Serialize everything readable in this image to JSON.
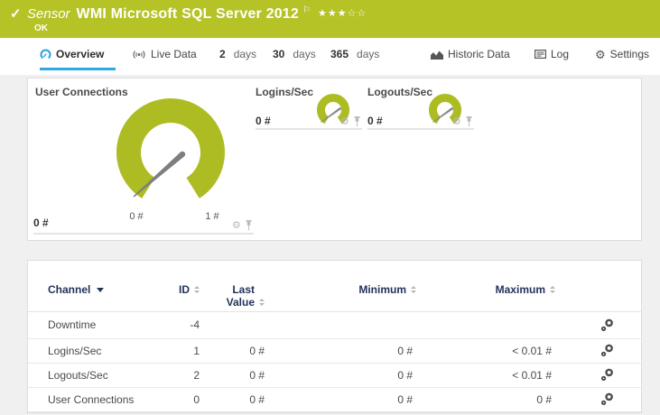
{
  "colors": {
    "status_ok_green": "#b5c327",
    "gauge_green": "#adbc23",
    "tab_active_blue": "#2da9e2"
  },
  "icons": {
    "check": "✓",
    "flag": "⚐",
    "gear": "⚙"
  },
  "header": {
    "kind_label": "Sensor",
    "title": "WMI Microsoft SQL Server 2012",
    "stars": "★★★☆☆",
    "status": "OK"
  },
  "tabs": [
    {
      "label": "Overview",
      "active": true
    },
    {
      "label": "Live Data"
    },
    {
      "num": "2",
      "unit": "days"
    },
    {
      "num": "30",
      "unit": "days"
    },
    {
      "num": "365",
      "unit": "days"
    },
    {
      "label": "Historic Data"
    },
    {
      "label": "Log"
    },
    {
      "label": "Settings"
    }
  ],
  "gauges": {
    "user_connections": {
      "title": "User Connections",
      "value": "0 #",
      "scale_min": "0 #",
      "scale_max": "1 #"
    },
    "logins_sec": {
      "title": "Logins/Sec",
      "value": "0 #"
    },
    "logouts_sec": {
      "title": "Logouts/Sec",
      "value": "0 #"
    }
  },
  "table": {
    "headers": {
      "channel": "Channel",
      "id": "ID",
      "last_value": "Last Value",
      "minimum": "Minimum",
      "maximum": "Maximum"
    },
    "rows": [
      {
        "channel": "Downtime",
        "id": "-4",
        "last": "",
        "min": "",
        "max": ""
      },
      {
        "channel": "Logins/Sec",
        "id": "1",
        "last": "0 #",
        "min": "0 #",
        "max": "< 0.01 #"
      },
      {
        "channel": "Logouts/Sec",
        "id": "2",
        "last": "0 #",
        "min": "0 #",
        "max": "< 0.01 #"
      },
      {
        "channel": "User Connections",
        "id": "0",
        "last": "0 #",
        "min": "0 #",
        "max": "0 #"
      }
    ]
  }
}
